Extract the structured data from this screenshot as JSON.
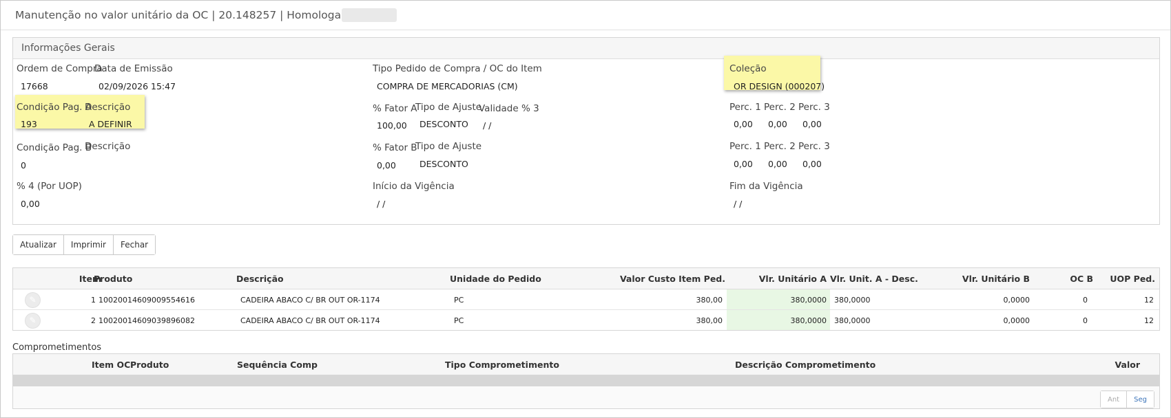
{
  "title": {
    "text": "Manutenção no valor unitário da OC | 20.148257 | Homologação |"
  },
  "general": {
    "header": "Informações Gerais",
    "ordem_compra_label": "Ordem de Compra",
    "ordem_compra_value": "17668",
    "data_emissao_label": "Data de Emissão",
    "data_emissao_value": "02/09/2026 15:47",
    "tipo_pedido_label": "Tipo Pedido de Compra / OC do Item",
    "tipo_pedido_value": "COMPRA DE MERCADORIAS (CM)",
    "colecao_label": "Coleção",
    "colecao_value": "OR DESIGN (000207)",
    "cond_pag_a_label": "Condição Pag. A",
    "cond_pag_a_desc_label": "Descrição",
    "cond_pag_a_value": "193",
    "cond_pag_a_desc_value": "A DEFINIR",
    "fator_a_label": "% Fator A",
    "fator_a_value": "100,00",
    "tipo_ajuste_a_label": "Tipo de Ajuste",
    "tipo_ajuste_a_value": "DESCONTO",
    "validade3_label": "Validade % 3",
    "validade3_value": "/ /",
    "perc_a": {
      "p1_label": "Perc. 1",
      "p2_label": "Perc. 2",
      "p3_label": "Perc. 3",
      "p1": "0,00",
      "p2": "0,00",
      "p3": "0,00"
    },
    "cond_pag_b_label": "Condição Pag. B",
    "cond_pag_b_desc_label": "Descrição",
    "cond_pag_b_value": "0",
    "fator_b_label": "% Fator B",
    "fator_b_value": "0,00",
    "tipo_ajuste_b_label": "Tipo de Ajuste",
    "tipo_ajuste_b_value": "DESCONTO",
    "perc_b": {
      "p1_label": "Perc. 1",
      "p2_label": "Perc. 2",
      "p3_label": "Perc. 3",
      "p1": "0,00",
      "p2": "0,00",
      "p3": "0,00"
    },
    "perc4_label": "% 4 (Por UOP)",
    "perc4_value": "0,00",
    "inicio_vigencia_label": "Início da Vigência",
    "inicio_vigencia_value": "/ /",
    "fim_vigencia_label": "Fim da Vigência",
    "fim_vigencia_value": "/ /"
  },
  "toolbar": {
    "atualizar": "Atualizar",
    "imprimir": "Imprimir",
    "fechar": "Fechar"
  },
  "items": {
    "headers": {
      "item": "Item",
      "produto": "Produto",
      "descricao": "Descrição",
      "unidade": "Unidade do Pedido",
      "valor_custo": "Valor Custo Item Ped.",
      "vlr_unit_a": "Vlr. Unitário A",
      "vlr_unit_a_desc": "Vlr. Unit. A - Desc.",
      "vlr_unit_b": "Vlr. Unitário B",
      "oc_b": "OC B",
      "uop": "UOP Ped."
    },
    "rows": [
      {
        "item": "1",
        "produto": "10020014609009554616",
        "descricao": "CADEIRA ABACO C/ BR OUT OR-1174",
        "unidade": "PC",
        "valor_custo": "380,00",
        "vlr_unit_a": "380,0000",
        "vlr_unit_a_desc": "380,0000",
        "vlr_unit_b": "0,0000",
        "oc_b": "0",
        "uop": "12"
      },
      {
        "item": "2",
        "produto": "10020014609039896082",
        "descricao": "CADEIRA ABACO C/ BR OUT OR-1174",
        "unidade": "PC",
        "valor_custo": "380,00",
        "vlr_unit_a": "380,0000",
        "vlr_unit_a_desc": "380,0000",
        "vlr_unit_b": "0,0000",
        "oc_b": "0",
        "uop": "12"
      }
    ]
  },
  "commitments": {
    "title": "Comprometimentos",
    "headers": {
      "item_oc": "Item OC",
      "produto": "Produto",
      "sequencia": "Sequência Comp",
      "tipo": "Tipo Comprometimento",
      "descricao": "Descrição Comprometimento",
      "valor": "Valor"
    },
    "pager": {
      "prev": "Ant",
      "next": "Seg"
    }
  },
  "colors": {
    "highlight": "#fbf8a7",
    "green_cell": "#e8f7e4",
    "link": "#3b73b9"
  }
}
